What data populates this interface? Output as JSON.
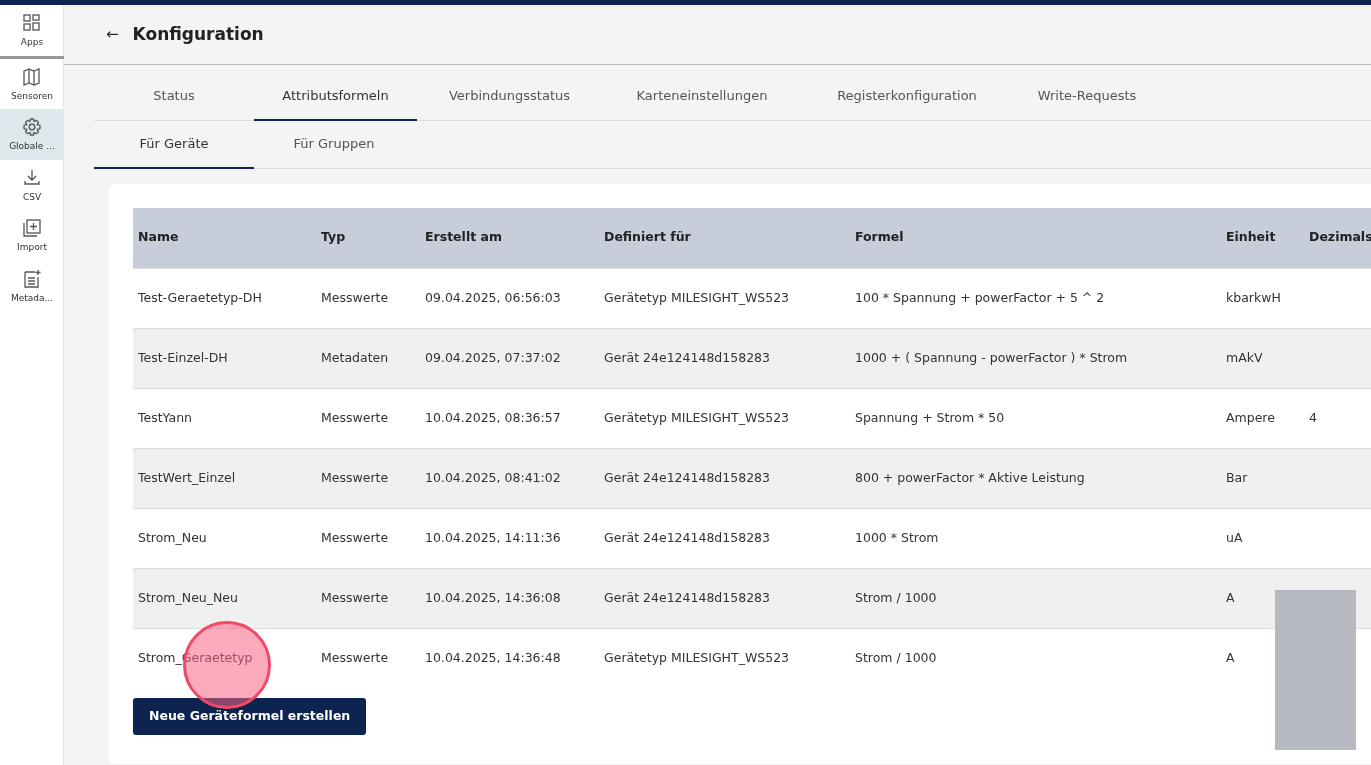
{
  "sidebar": {
    "items": [
      {
        "label": "Apps",
        "kind": "apps",
        "selected": false
      },
      {
        "label": "Sensoren",
        "kind": "map",
        "selected": false
      },
      {
        "label": "Globale ...",
        "kind": "gear",
        "selected": true
      },
      {
        "label": "CSV",
        "kind": "download",
        "selected": false
      },
      {
        "label": "Import",
        "kind": "import",
        "selected": false
      },
      {
        "label": "Metada...",
        "kind": "document",
        "selected": false
      }
    ]
  },
  "header": {
    "back": "←",
    "title": "Konfiguration"
  },
  "tabs": [
    {
      "label": "Status",
      "selected": false
    },
    {
      "label": "Attributsformeln",
      "selected": true
    },
    {
      "label": "Verbindungsstatus",
      "selected": false
    },
    {
      "label": "Karteneinstellungen",
      "selected": false
    },
    {
      "label": "Registerkonfiguration",
      "selected": false
    },
    {
      "label": "Write-Requests",
      "selected": false
    }
  ],
  "subtabs": [
    {
      "label": "Für Geräte",
      "selected": true
    },
    {
      "label": "Für Gruppen",
      "selected": false
    }
  ],
  "table": {
    "columns": [
      "Name",
      "Typ",
      "Erstellt am",
      "Definiert für",
      "Formel",
      "Einheit",
      "Dezimals"
    ],
    "rows": [
      [
        "Test-Geraetetyp-DH",
        "Messwerte",
        "09.04.2025, 06:56:03",
        "Gerätetyp MILESIGHT_WS523",
        "100 * Spannung + powerFactor + 5 ^ 2",
        "kbarkwH",
        ""
      ],
      [
        "Test-Einzel-DH",
        "Metadaten",
        "09.04.2025, 07:37:02",
        "Gerät 24e124148d158283",
        "1000 + ( Spannung - powerFactor ) * Strom",
        "mAkV",
        ""
      ],
      [
        "TestYann",
        "Messwerte",
        "10.04.2025, 08:36:57",
        "Gerätetyp MILESIGHT_WS523",
        "Spannung + Strom * 50",
        "Ampere",
        "4"
      ],
      [
        "TestWert_Einzel",
        "Messwerte",
        "10.04.2025, 08:41:02",
        "Gerät 24e124148d158283",
        "800 + powerFactor * Aktive Leistung",
        "Bar",
        ""
      ],
      [
        "Strom_Neu",
        "Messwerte",
        "10.04.2025, 14:11:36",
        "Gerät 24e124148d158283",
        "1000 * Strom",
        "uA",
        ""
      ],
      [
        "Strom_Neu_Neu",
        "Messwerte",
        "10.04.2025, 14:36:08",
        "Gerät 24e124148d158283",
        "Strom / 1000",
        "A",
        ""
      ],
      [
        "Strom_Geraetetyp",
        "Messwerte",
        "10.04.2025, 14:36:48",
        "Gerätetyp MILESIGHT_WS523",
        "Strom / 1000",
        "A",
        ""
      ]
    ]
  },
  "create_button": "Neue Geräteformel erstellen"
}
